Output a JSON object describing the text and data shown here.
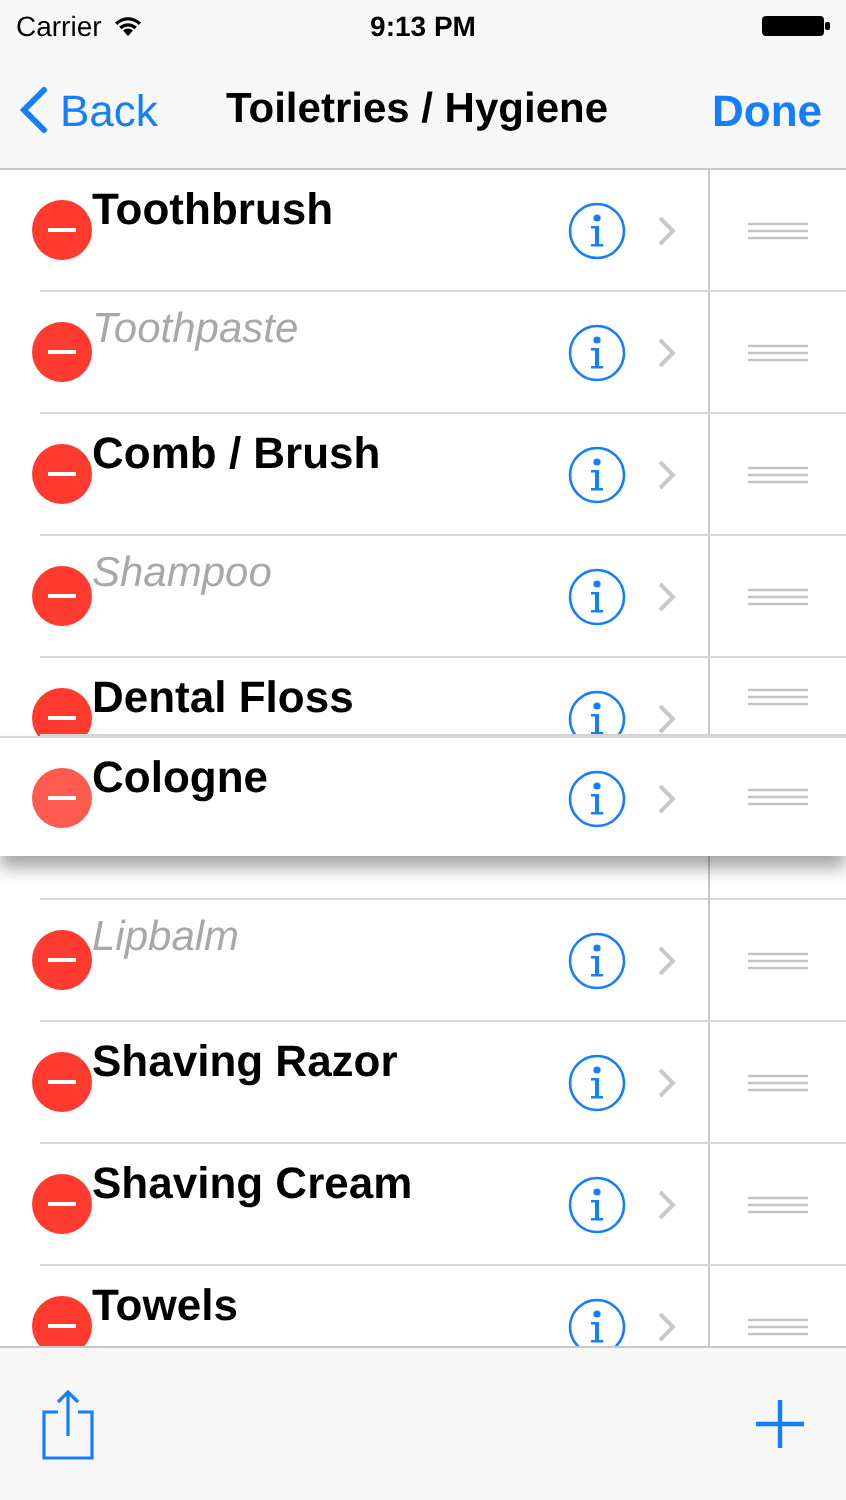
{
  "status_bar": {
    "carrier": "Carrier",
    "time": "9:13 PM"
  },
  "nav_bar": {
    "back": "Back",
    "title": "Toiletries / Hygiene",
    "done": "Done"
  },
  "items": [
    {
      "title": "Toothbrush",
      "completed": false,
      "dragging": false
    },
    {
      "title": "Toothpaste",
      "completed": true,
      "dragging": false
    },
    {
      "title": "Comb / Brush",
      "completed": false,
      "dragging": false
    },
    {
      "title": "Shampoo",
      "completed": true,
      "dragging": false
    },
    {
      "title": "Dental Floss",
      "completed": false,
      "dragging": false
    },
    {
      "title": "Cologne",
      "completed": false,
      "dragging": true
    },
    {
      "title": "Lipbalm",
      "completed": true,
      "dragging": false
    },
    {
      "title": "Shaving Razor",
      "completed": false,
      "dragging": false
    },
    {
      "title": "Shaving Cream",
      "completed": false,
      "dragging": false
    },
    {
      "title": "Towels",
      "completed": false,
      "dragging": false
    }
  ]
}
